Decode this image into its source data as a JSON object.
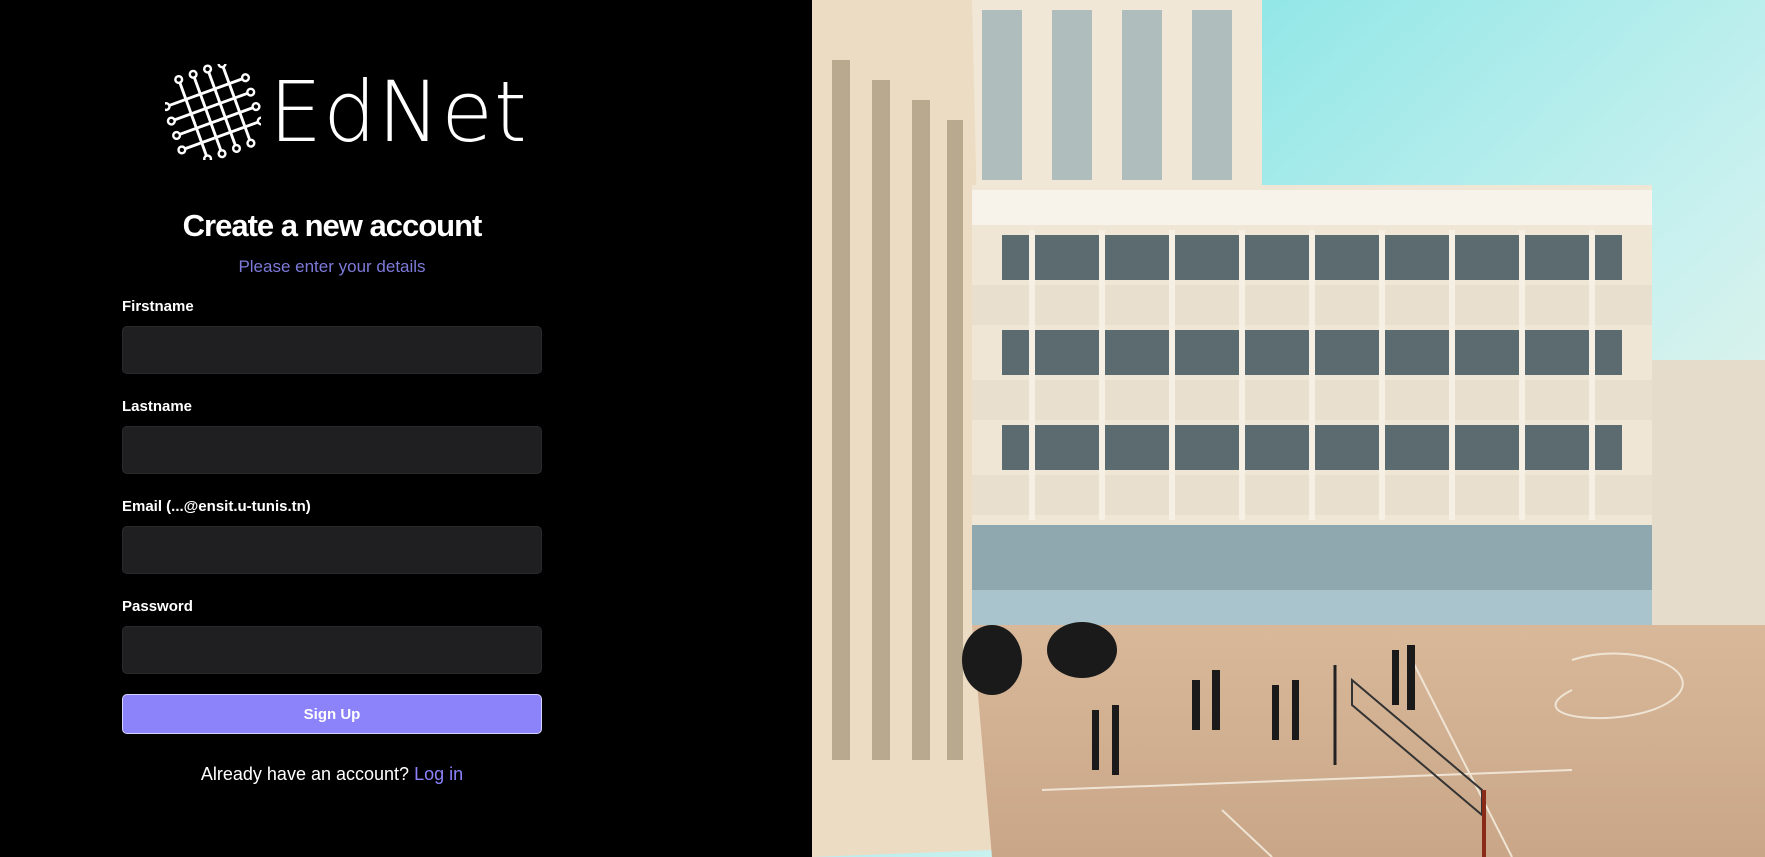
{
  "brand": {
    "name": "EdNet",
    "logo_icon": "mesh-network-icon"
  },
  "form": {
    "title": "Create a new account",
    "subtitle": "Please enter your details",
    "fields": [
      {
        "label": "Firstname",
        "value": "",
        "placeholder": ""
      },
      {
        "label": "Lastname",
        "value": "",
        "placeholder": ""
      },
      {
        "label": "Email (...@ensit.u-tunis.tn)",
        "value": "",
        "placeholder": ""
      },
      {
        "label": "Password",
        "value": "",
        "placeholder": ""
      }
    ],
    "submit_label": "Sign Up",
    "footer_text": "Already have an account?",
    "login_link": "Log in"
  },
  "colors": {
    "background": "#000000",
    "accent": "#8c83fb",
    "subtitle": "#7d7ad9",
    "input_bg": "#1f1f21"
  },
  "hero_image": {
    "subject": "campus-courtyard-photo"
  }
}
